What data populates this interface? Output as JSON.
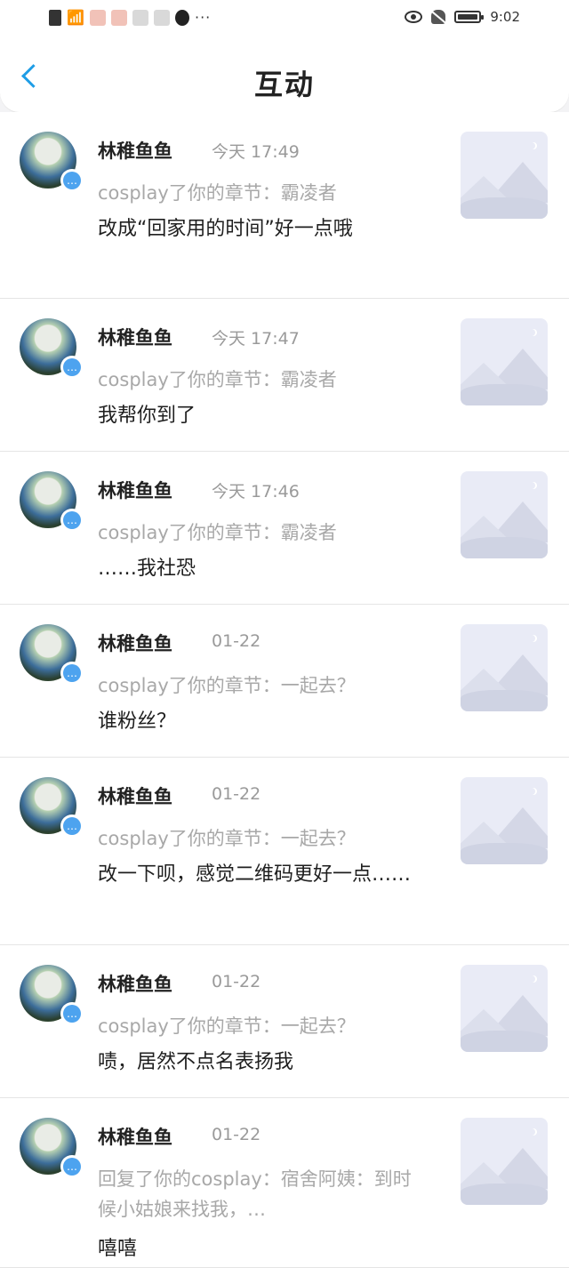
{
  "statusbar": {
    "time": "9:02"
  },
  "nav": {
    "title": "互动"
  },
  "items": [
    {
      "name": "林稚鱼鱼",
      "time": "今天 17:49",
      "context": "cosplay了你的章节：霸凌者",
      "text": "改成“回家用的时间”好一点哦"
    },
    {
      "name": "林稚鱼鱼",
      "time": "今天 17:47",
      "context": "cosplay了你的章节：霸凌者",
      "text": "我帮你到了"
    },
    {
      "name": "林稚鱼鱼",
      "time": "今天 17:46",
      "context": "cosplay了你的章节：霸凌者",
      "text": "……我社恐"
    },
    {
      "name": "林稚鱼鱼",
      "time": "01-22",
      "context": "cosplay了你的章节：一起去？",
      "text": "谁粉丝？"
    },
    {
      "name": "林稚鱼鱼",
      "time": "01-22",
      "context": "cosplay了你的章节：一起去？",
      "text": "改一下呗，感觉二维码更好一点……"
    },
    {
      "name": "林稚鱼鱼",
      "time": "01-22",
      "context": "cosplay了你的章节：一起去？",
      "text": "啧，居然不点名表扬我"
    },
    {
      "name": "林稚鱼鱼",
      "time": "01-22",
      "context": "回复了你的cosplay：宿舍阿姨：到时候小姑娘来找我，…",
      "text": "嘻嘻"
    }
  ]
}
